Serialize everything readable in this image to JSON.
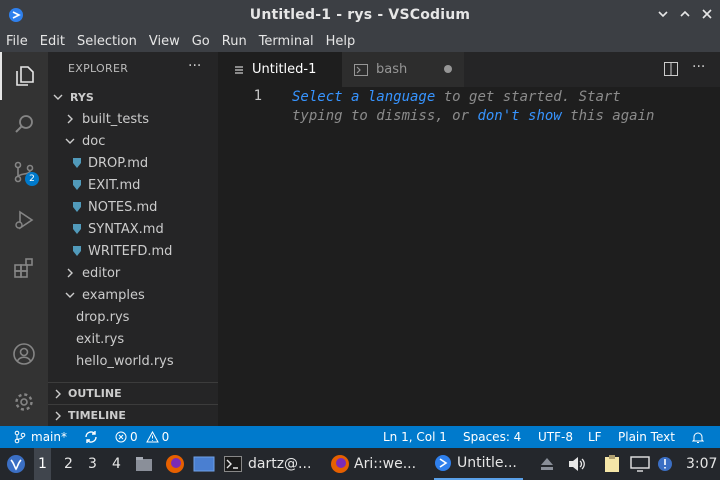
{
  "window": {
    "title": "Untitled-1 - rys - VSCodium"
  },
  "menu": [
    "File",
    "Edit",
    "Selection",
    "View",
    "Go",
    "Run",
    "Terminal",
    "Help"
  ],
  "activity": {
    "scm_badge": "2",
    "items": [
      "explorer-icon",
      "search-icon",
      "source-control-icon",
      "run-debug-icon",
      "extensions-icon",
      "account-icon",
      "settings-gear-icon"
    ]
  },
  "explorer": {
    "header": "EXPLORER",
    "more": "···",
    "root": "RYS",
    "tree": [
      {
        "label": "built_tests",
        "type": "folder",
        "expanded": false,
        "depth": 1
      },
      {
        "label": "doc",
        "type": "folder",
        "expanded": true,
        "depth": 1
      },
      {
        "label": "DROP.md",
        "type": "md",
        "depth": 2
      },
      {
        "label": "EXIT.md",
        "type": "md",
        "depth": 2
      },
      {
        "label": "NOTES.md",
        "type": "md",
        "depth": 2
      },
      {
        "label": "SYNTAX.md",
        "type": "md",
        "depth": 2
      },
      {
        "label": "WRITEFD.md",
        "type": "md",
        "depth": 2
      },
      {
        "label": "editor",
        "type": "folder",
        "expanded": false,
        "depth": 1
      },
      {
        "label": "examples",
        "type": "folder",
        "expanded": true,
        "depth": 1
      },
      {
        "label": "drop.rys",
        "type": "file",
        "depth": 2
      },
      {
        "label": "exit.rys",
        "type": "file",
        "depth": 2
      },
      {
        "label": "hello_world.rys",
        "type": "file",
        "depth": 2
      }
    ],
    "outline": "OUTLINE",
    "timeline": "TIMELINE"
  },
  "editor": {
    "tabs": [
      {
        "label": "Untitled-1",
        "active": true
      },
      {
        "label": "bash",
        "active": false
      }
    ],
    "line_number": "1",
    "hint": {
      "link1": "Select a language",
      "text1": " to get started. Start",
      "text2": "typing to dismiss, or ",
      "link2": "don't show",
      "text3": " this again"
    }
  },
  "status": {
    "branch": "main*",
    "errors": "0",
    "warnings": "0",
    "position": "Ln 1, Col 1",
    "spaces": "Spaces: 4",
    "encoding": "UTF-8",
    "eol": "LF",
    "language": "Plain Text"
  },
  "taskbar": {
    "workspaces": [
      "1",
      "2",
      "3",
      "4"
    ],
    "tasks": [
      {
        "label": "dartz@...",
        "icon": "terminal-icon"
      },
      {
        "label": "Ari::we...",
        "icon": "firefox-icon"
      },
      {
        "label": "Untitle...",
        "icon": "vscodium-icon",
        "active": true
      }
    ],
    "clock": "3:07"
  },
  "colors": {
    "accent": "#007acc",
    "link": "#3794ff"
  }
}
